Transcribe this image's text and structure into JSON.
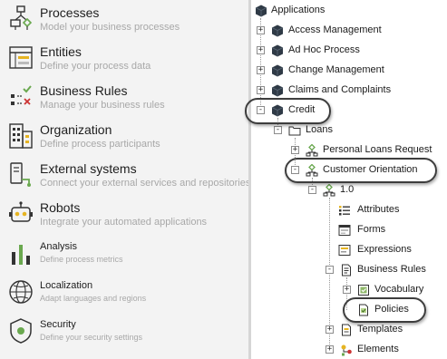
{
  "nav": {
    "items": [
      {
        "title": "Processes",
        "subtitle": "Model your business processes",
        "icon": "process-flow-icon"
      },
      {
        "title": "Entities",
        "subtitle": "Define your process data",
        "icon": "entities-window-icon"
      },
      {
        "title": "Business Rules",
        "subtitle": "Manage your business rules",
        "icon": "business-rules-icon"
      },
      {
        "title": "Organization",
        "subtitle": "Define process participants",
        "icon": "organization-building-icon"
      },
      {
        "title": "External systems",
        "subtitle": "Connect your external services and repositories",
        "icon": "external-systems-icon"
      },
      {
        "title": "Robots",
        "subtitle": "Integrate your automated applications",
        "icon": "robot-icon"
      },
      {
        "title": "Analysis",
        "subtitle": "Define process metrics",
        "icon": "analysis-chart-icon"
      },
      {
        "title": "Localization",
        "subtitle": "Adapt languages and regions",
        "icon": "globe-icon"
      },
      {
        "title": "Security",
        "subtitle": "Define your security settings",
        "icon": "security-shield-icon"
      }
    ]
  },
  "tree": {
    "root": "Applications",
    "items": [
      {
        "label": "Access Management",
        "toggle": "+"
      },
      {
        "label": "Ad Hoc Process",
        "toggle": "+"
      },
      {
        "label": "Change Management",
        "toggle": "+"
      },
      {
        "label": "Claims and Complaints",
        "toggle": "+"
      },
      {
        "label": "Credit",
        "toggle": "-"
      },
      {
        "label": "Loans",
        "toggle": "-"
      },
      {
        "label": "Personal Loans Request",
        "toggle": "+"
      },
      {
        "label": "Customer Orientation",
        "toggle": "-"
      },
      {
        "label": "1.0",
        "toggle": "-"
      },
      {
        "label": "Attributes",
        "toggle": ""
      },
      {
        "label": "Forms",
        "toggle": ""
      },
      {
        "label": "Expressions",
        "toggle": ""
      },
      {
        "label": "Business Rules",
        "toggle": "-"
      },
      {
        "label": "Vocabulary",
        "toggle": "+"
      },
      {
        "label": "Policies",
        "toggle": ""
      },
      {
        "label": "Templates",
        "toggle": "+"
      },
      {
        "label": "Elements",
        "toggle": "+"
      }
    ]
  },
  "colors": {
    "cube": "#2f3a46",
    "accent_green": "#6aa84f",
    "accent_yellow": "#e6b422",
    "callout_border": "#3d3d3d"
  }
}
